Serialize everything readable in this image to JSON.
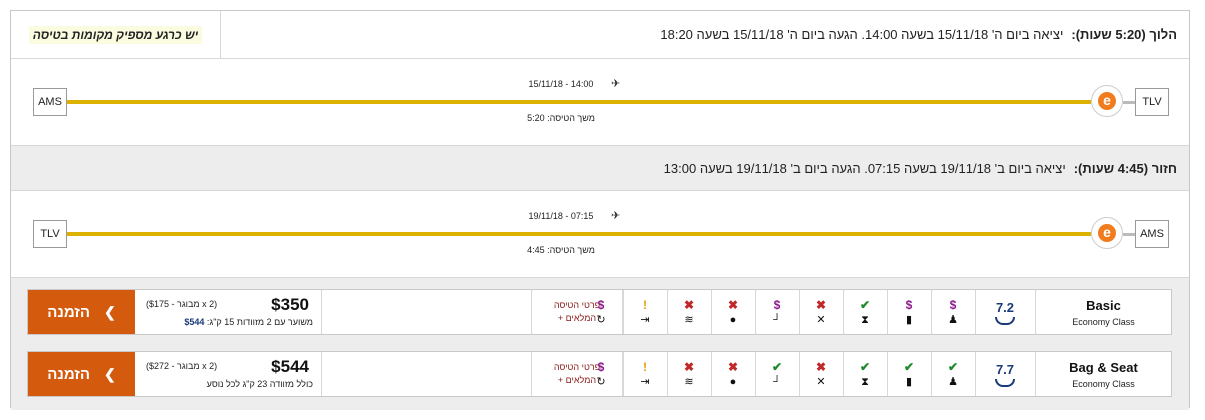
{
  "outbound": {
    "label": "הלוך (5:20 שעות):",
    "description": "יציאה ביום ה' 15/11/18 בשעה 14:00. הגעה ביום ה' 15/11/18 בשעה 18:20",
    "seats_notice": "יש כרגע מספיק מקומות בטיסה",
    "from": "TLV",
    "to": "AMS",
    "datetime": "15/11/18 - 14:00",
    "duration_label": "משך הטיסה:",
    "duration": "5:20"
  },
  "return": {
    "label": "חזור (4:45 שעות):",
    "description": "יציאה ביום ב' 19/11/18 בשעה 07:15. הגעה ביום ב' 19/11/18 בשעה 13:00",
    "from": "AMS",
    "to": "TLV",
    "datetime": "19/11/18 - 07:15",
    "duration_label": "משך הטיסה:",
    "duration": "4:45"
  },
  "airline_logo_letter": "e",
  "plane_glyph": "✈",
  "fares": [
    {
      "name": "Basic",
      "class": "Economy Class",
      "score": "7.2",
      "price": "$350",
      "price_breakdown": "(2 x מבוגר - $175)",
      "note_prefix": "משוער עם 2 מזוודות 15 ק\"ג:",
      "note_value": "$544",
      "details_line1": "פרטי הטיסה",
      "details_line2": "המלאים +",
      "book_label": "הזמנה",
      "book_chevron": "❮",
      "features": [
        {
          "name": "seat-selection",
          "status": "$",
          "glyph": "♟"
        },
        {
          "name": "checked-bag",
          "status": "$",
          "glyph": "▮"
        },
        {
          "name": "hand-luggage",
          "status": "✔",
          "glyph": "⧗"
        },
        {
          "name": "meal",
          "status": "✖",
          "glyph": "✕"
        },
        {
          "name": "drink",
          "status": "$",
          "glyph": "┘"
        },
        {
          "name": "entertainment",
          "status": "✖",
          "glyph": "●"
        },
        {
          "name": "wifi",
          "status": "✖",
          "glyph": "≋"
        },
        {
          "name": "power-outlet",
          "status": "!",
          "glyph": "⇥"
        },
        {
          "name": "change-flight",
          "status": "$",
          "glyph": "↻"
        }
      ]
    },
    {
      "name": "Bag & Seat",
      "class": "Economy Class",
      "score": "7.7",
      "price": "$544",
      "price_breakdown": "(2 x מבוגר - $272)",
      "note_prefix": "כולל מזוודה 23 ק\"ג לכל נוסע",
      "note_value": "",
      "details_line1": "פרטי הטיסה",
      "details_line2": "המלאים +",
      "book_label": "הזמנה",
      "book_chevron": "❮",
      "features": [
        {
          "name": "seat-selection",
          "status": "✔",
          "glyph": "♟"
        },
        {
          "name": "checked-bag",
          "status": "✔",
          "glyph": "▮"
        },
        {
          "name": "hand-luggage",
          "status": "✔",
          "glyph": "⧗"
        },
        {
          "name": "meal",
          "status": "✖",
          "glyph": "✕"
        },
        {
          "name": "drink",
          "status": "✔",
          "glyph": "┘"
        },
        {
          "name": "entertainment",
          "status": "✖",
          "glyph": "●"
        },
        {
          "name": "wifi",
          "status": "✖",
          "glyph": "≋"
        },
        {
          "name": "power-outlet",
          "status": "!",
          "glyph": "⇥"
        },
        {
          "name": "change-flight",
          "status": "$",
          "glyph": "↻"
        }
      ]
    }
  ]
}
